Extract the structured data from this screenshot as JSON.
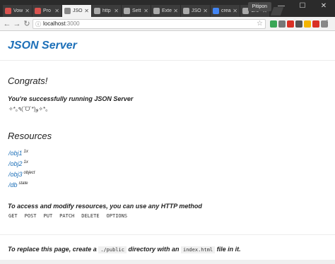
{
  "browser": {
    "tabs": [
      {
        "label": "Vow",
        "color": "#d9534f"
      },
      {
        "label": "Pro",
        "color": "#d9534f"
      },
      {
        "label": "JSO",
        "color": "#888888"
      },
      {
        "label": "http",
        "color": "#aaaaaa"
      },
      {
        "label": "Sett",
        "color": "#aaaaaa"
      },
      {
        "label": "Exte",
        "color": "#aaaaaa"
      },
      {
        "label": "JSO",
        "color": "#aaaaaa"
      },
      {
        "label": "crea",
        "color": "#4285f4"
      },
      {
        "label": "Cre",
        "color": "#aaaaaa"
      }
    ],
    "active_tab": 2,
    "profile_name": "Pitipon",
    "url_host": "localhost",
    "url_port": ":3000",
    "window_controls": {
      "minimize": "—",
      "maximize": "☐",
      "close": "✕"
    },
    "extension_colors": [
      "#3aa757",
      "#777777",
      "#d93025",
      "#555555",
      "#f4b400",
      "#d93025",
      "#888888"
    ]
  },
  "page": {
    "logo": "JSON Server",
    "congrats_heading": "Congrats!",
    "congrats_text": "You're successfully running JSON Server",
    "kaomoji": "✧*｡٩(ˊᗜˋ*)و✧*｡",
    "resources_heading": "Resources",
    "resources": [
      {
        "path": "/obj1",
        "note": "1x"
      },
      {
        "path": "/obj2",
        "note": "1x"
      },
      {
        "path": "/obj3",
        "note": "object"
      },
      {
        "path": "/db",
        "note": "state"
      }
    ],
    "methods_text": "To access and modify resources, you can use any HTTP method",
    "methods": [
      "GET",
      "POST",
      "PUT",
      "PATCH",
      "DELETE",
      "OPTIONS"
    ],
    "footer": {
      "part1": "To replace this page, create a",
      "code1": "./public",
      "part2": "directory with an",
      "code2": "index.html",
      "part3": "file in it."
    }
  }
}
